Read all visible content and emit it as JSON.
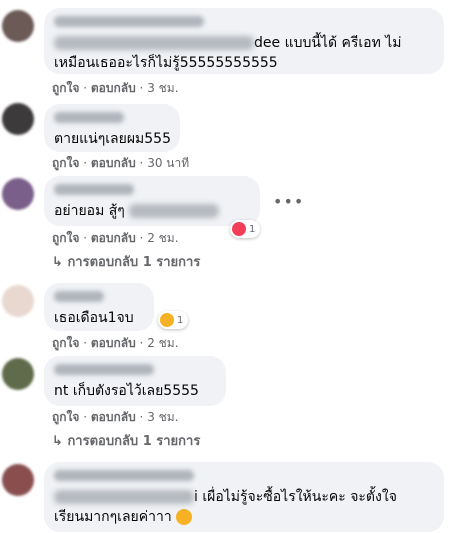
{
  "comments": [
    {
      "text_line1": "dee แบบนี้ได้ ครีเอท ไม่",
      "text_line2": "เหมือนเธออะไรก็ไม่รู้55555555555",
      "like": "ถูกใจ",
      "reply": "ตอบกลับ",
      "time": "3 ชม."
    },
    {
      "text_line1": "ตายแน่ๆเลยผม555",
      "like": "ถูกใจ",
      "reply": "ตอบกลับ",
      "time": "30 นาที"
    },
    {
      "text_line1": "อย่ายอม สู้ๆ",
      "reaction_count": "1",
      "like": "ถูกใจ",
      "reply": "ตอบกลับ",
      "time": "2 ชม.",
      "replies_link": "การตอบกลับ 1 รายการ"
    },
    {
      "text_line1": "เธอเดือน1จบ",
      "reaction_count": "1",
      "like": "ถูกใจ",
      "reply": "ตอบกลับ",
      "time": "2 ชม."
    },
    {
      "text_line1": "nt เก็บตังรอไว้เลย5555",
      "like": "ถูกใจ",
      "reply": "ตอบกลับ",
      "time": "3 ชม.",
      "replies_link": "การตอบกลับ 1 รายการ"
    },
    {
      "text_line1": "i เผื่อไม่รู้จะซื้อไรให้นะคะ จะตั้งใจ",
      "text_line2": "เรียนมากๆเลยค่าาา"
    }
  ],
  "separator": " · ",
  "reply_arrow": "↳",
  "more_dots": "•••",
  "colors": {
    "bubble": "#f0f2f5",
    "meta": "#65676b",
    "text": "#050505"
  }
}
